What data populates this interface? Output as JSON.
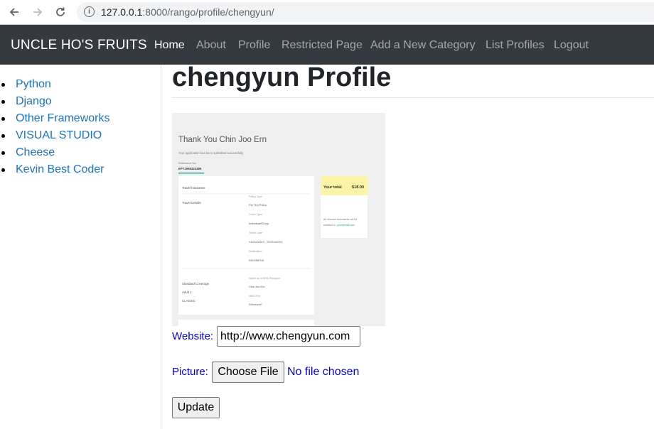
{
  "browser": {
    "url_host": "127.0.0.1",
    "url_rest": ":8000/rango/profile/chengyun/",
    "icons": [
      "back-arrow-icon",
      "forward-arrow-icon",
      "reload-icon",
      "info-icon"
    ]
  },
  "navbar": {
    "brand": "UNCLE HO'S FRUITS",
    "links": [
      {
        "label": "Home",
        "active": true
      },
      {
        "label": "About"
      },
      {
        "label": "Profile"
      },
      {
        "label": "Restricted Page"
      },
      {
        "label": "Add a New Category"
      },
      {
        "label": "List Profiles"
      },
      {
        "label": "Logout"
      }
    ]
  },
  "sidebar": {
    "items": [
      {
        "label": "Python"
      },
      {
        "label": "Django"
      },
      {
        "label": "Other Frameworks"
      },
      {
        "label": "VISUAL STUDIO"
      },
      {
        "label": "Cheese"
      },
      {
        "label": "Kevin Best Coder"
      }
    ]
  },
  "main": {
    "title": "chengyun Profile",
    "picture": {
      "heading": "Thank You Chin Joo Ern",
      "subtitle": "Your application has been submitted successfully",
      "reference_label": "Reference No",
      "reference_value": "EPT1998324386",
      "section": "Travel Insurance",
      "details_label": "Travel Details",
      "policy_label": "Policy Type",
      "policy_value": "Per Trip Policy",
      "cover_label": "Cover Type",
      "cover_value": "Individual/Group",
      "date_label": "Travel Date",
      "date_value": "XX/XX/20XX - XX/XX/20XX",
      "dest_label": "Destination",
      "dest_value": "INDONESIA",
      "coverage_label": "Standard Coverage",
      "adult_label": "Adult 1",
      "plan_label": "CLASSIC",
      "insured_label": "Name as in NRIC/Passport",
      "insured_value": "Chin Joo Ern",
      "nric_label": "NRIC/FIN",
      "nric_value": "S9xxxxxxF",
      "total_label": "Your total",
      "total_value": "$18.00",
      "email_note1": "All relevant documents will be",
      "email_note2": "emailed to",
      "email_link": "your@mail.com"
    },
    "website_label": "Website:",
    "website_value": "http://www.chengyun.com",
    "picture_label": "Picture:",
    "choose_file_label": "Choose File",
    "no_file_text": "No file chosen",
    "update_label": "Update"
  },
  "colors": {
    "navbar_bg": "#343a40",
    "link_blue": "#1a73c8",
    "form_label_blue": "#0000ee",
    "total_highlight": "#fdf3a6"
  }
}
